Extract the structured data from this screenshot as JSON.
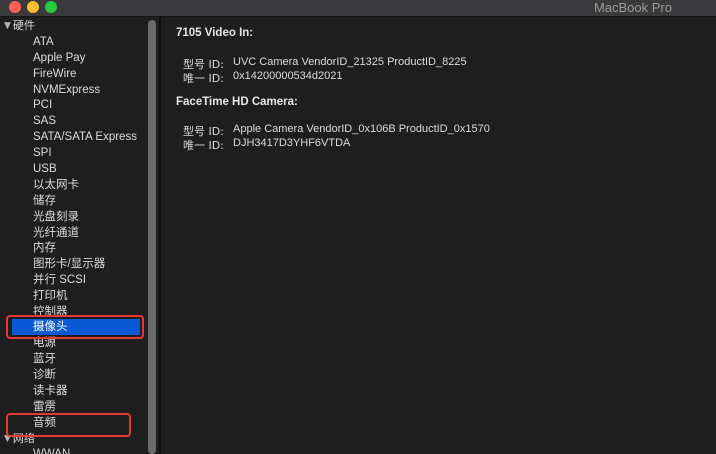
{
  "window": {
    "title": "MacBook Pro",
    "colors": {
      "background": "#1e1e1e",
      "selection": "#0a5ad6",
      "annotation": "#e53935",
      "close": "#fe5f57",
      "minimize": "#febc2e",
      "zoom": "#28c840"
    }
  },
  "sidebar": {
    "hardware_header": "硬件",
    "items": [
      {
        "label": "ATA"
      },
      {
        "label": "Apple Pay"
      },
      {
        "label": "FireWire"
      },
      {
        "label": "NVMExpress"
      },
      {
        "label": "PCI"
      },
      {
        "label": "SAS"
      },
      {
        "label": "SATA/SATA Express"
      },
      {
        "label": "SPI"
      },
      {
        "label": "USB"
      },
      {
        "label": "以太网卡"
      },
      {
        "label": "储存"
      },
      {
        "label": "光盘刻录"
      },
      {
        "label": "光纤通道"
      },
      {
        "label": "内存"
      },
      {
        "label": "图形卡/显示器"
      },
      {
        "label": "并行 SCSI"
      },
      {
        "label": "打印机"
      },
      {
        "label": "控制器"
      },
      {
        "label": "摄像头",
        "selected": true
      },
      {
        "label": "电源"
      },
      {
        "label": "蓝牙"
      },
      {
        "label": "诊断"
      },
      {
        "label": "读卡器"
      },
      {
        "label": "雷雳"
      },
      {
        "label": "音频"
      }
    ],
    "network_header": "网络",
    "network_items": [
      {
        "label": "WWAN"
      }
    ]
  },
  "content": {
    "sections": [
      {
        "title": "7105 Video In:",
        "rows": [
          {
            "label": "型号 ID:",
            "value": "UVC Camera VendorID_21325 ProductID_8225"
          },
          {
            "label": "唯一 ID:",
            "value": "0x14200000534d2021"
          }
        ]
      },
      {
        "title": "FaceTime HD Camera:",
        "rows": [
          {
            "label": "型号 ID:",
            "value": "Apple Camera VendorID_0x106B ProductID_0x1570"
          },
          {
            "label": "唯一 ID:",
            "value": "DJH3417D3YHF6VTDA"
          }
        ]
      }
    ]
  }
}
